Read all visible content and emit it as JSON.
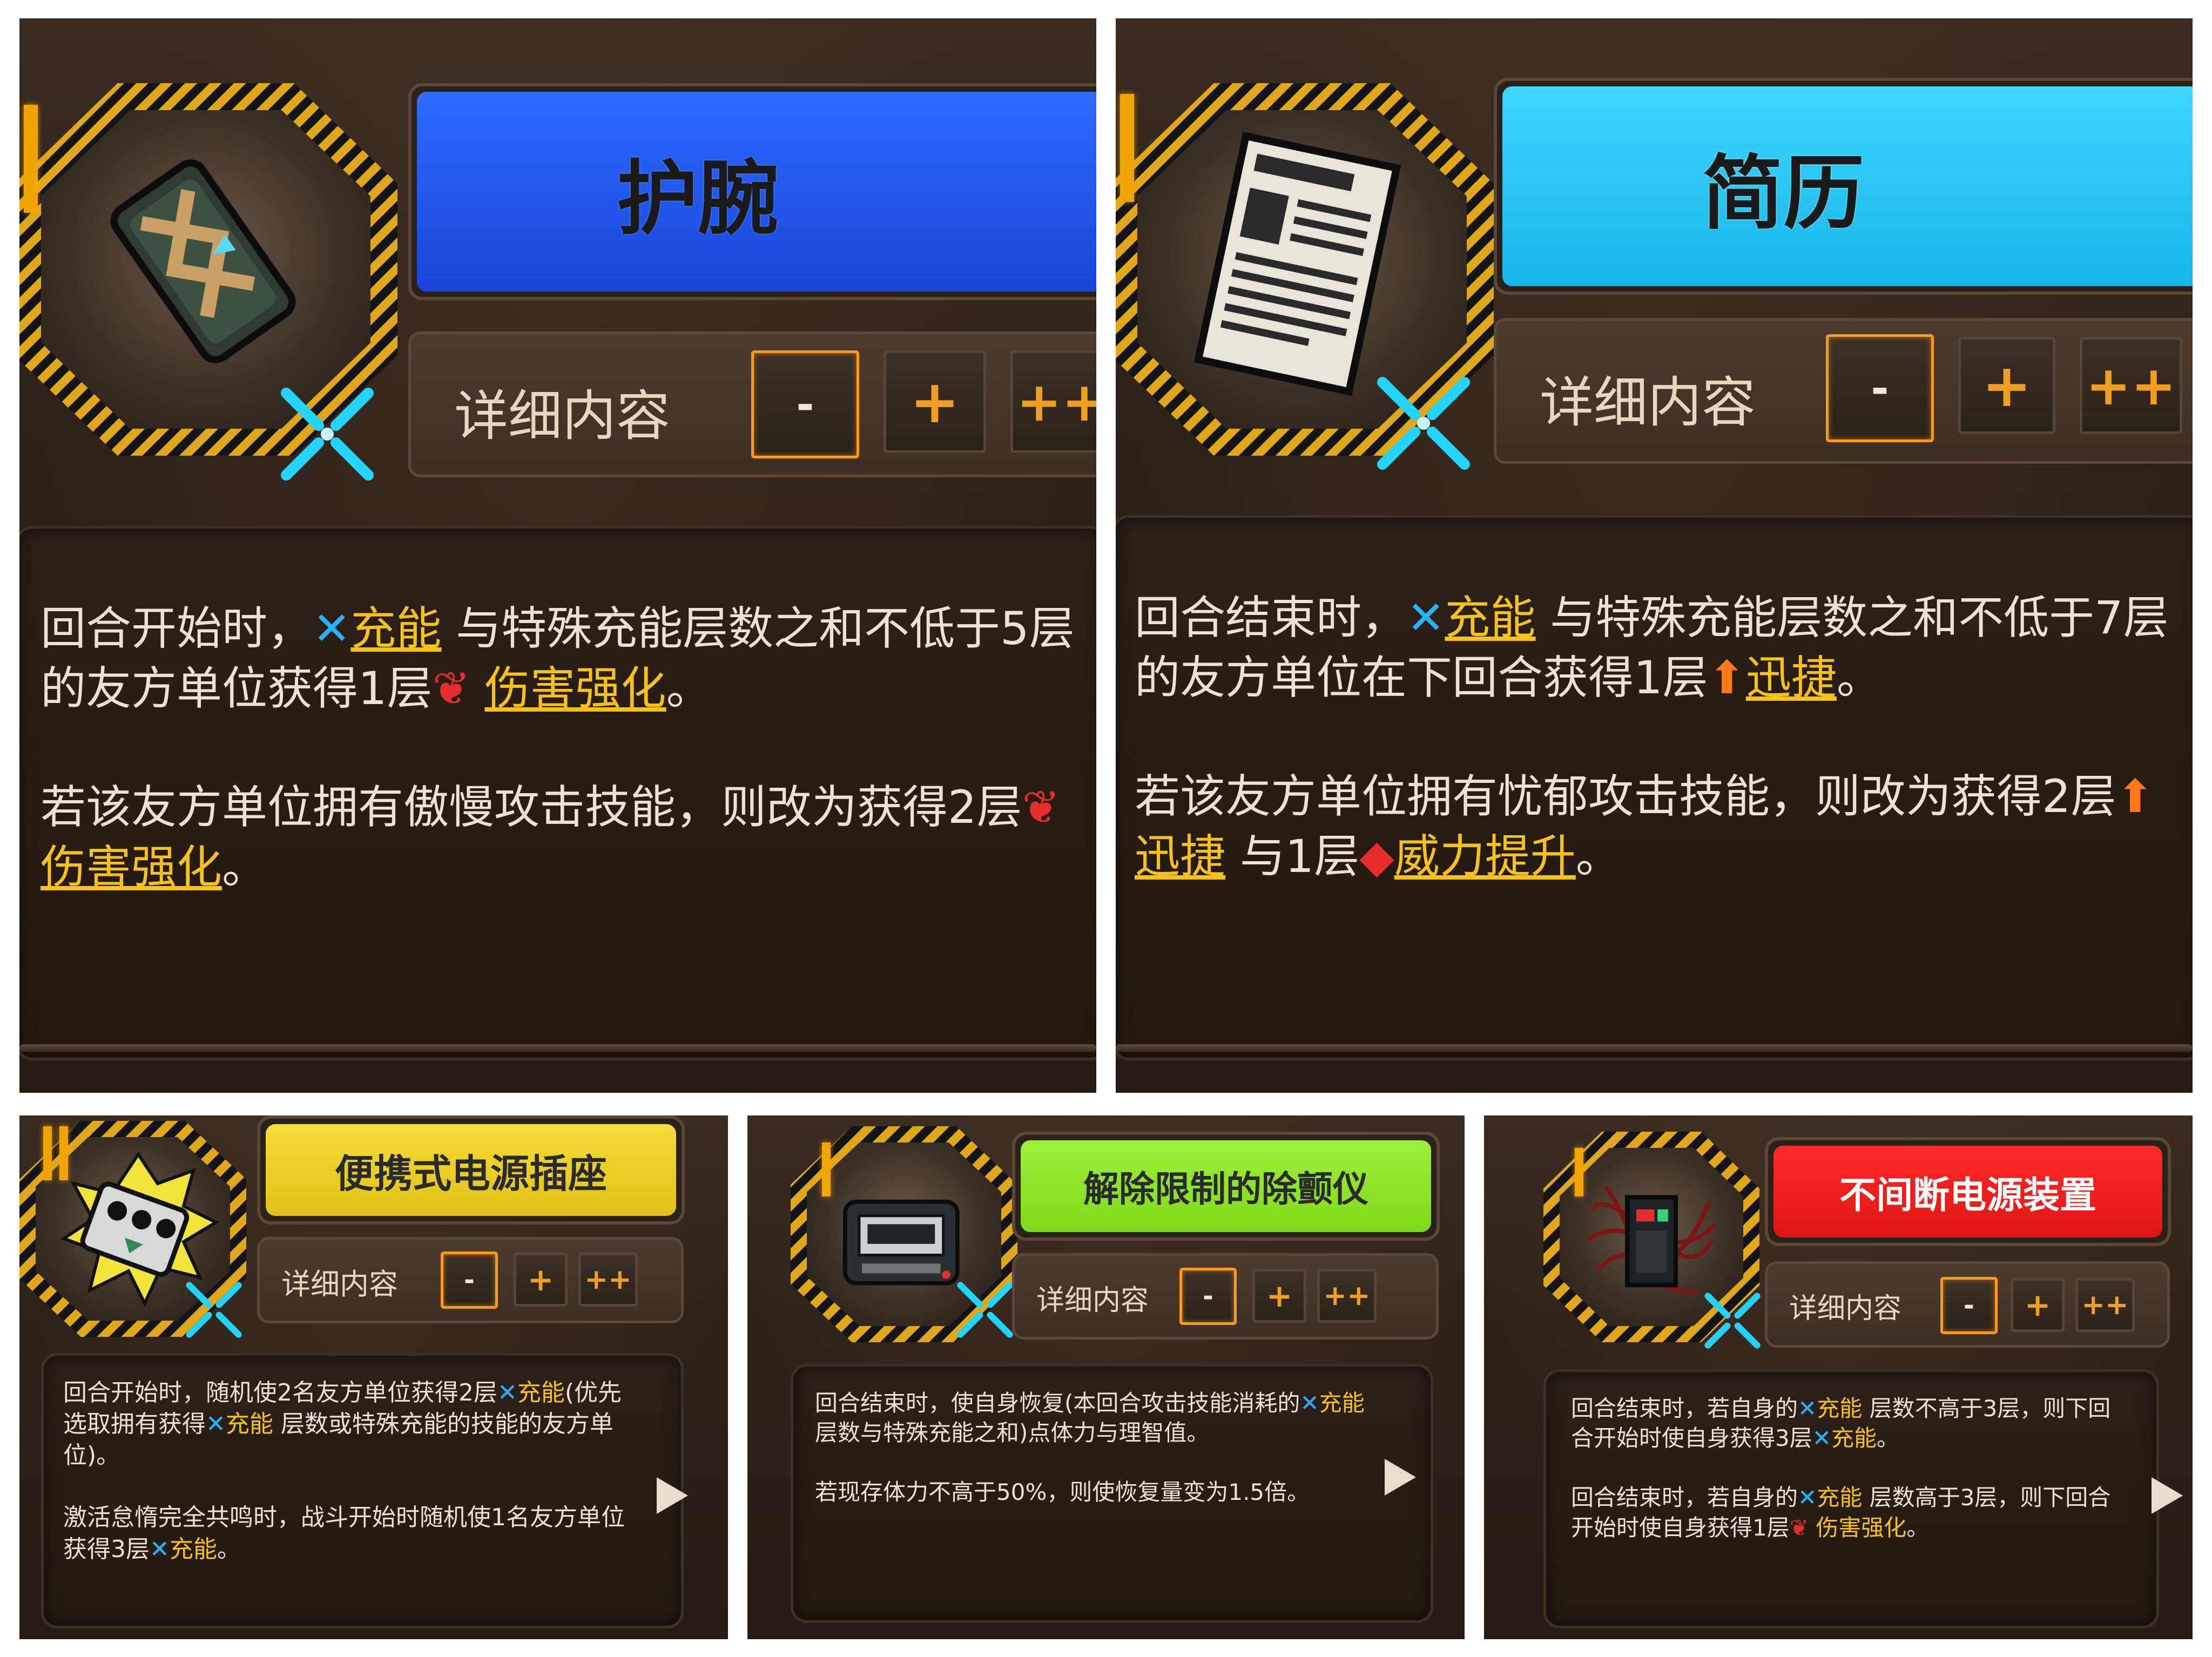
{
  "panels": [
    {
      "name": "护腕",
      "name_color": "#1f55f0",
      "detail_label": "详细内容",
      "buttons": [
        "-",
        "+",
        "++"
      ],
      "paragraphs": [
        [
          {
            "t": "回合开始时，"
          },
          {
            "t": "✕",
            "c": "kw-blue"
          },
          {
            "t": "充能",
            "c": "kw"
          },
          {
            "t": " 与特殊充能层数之和不低于5层的友方单位获得1层"
          },
          {
            "t": "❦",
            "c": "kw-red"
          },
          {
            "t": " "
          },
          {
            "t": "伤害强化",
            "c": "kw"
          },
          {
            "t": "。"
          }
        ],
        [
          {
            "t": "若该友方单位拥有傲慢攻击技能，则改为获得2层"
          },
          {
            "t": "❦",
            "c": "kw-red"
          },
          {
            "t": " "
          },
          {
            "t": "伤害强化",
            "c": "kw"
          },
          {
            "t": "。"
          }
        ]
      ]
    },
    {
      "name": "简历",
      "name_color": "#19c6f5",
      "detail_label": "详细内容",
      "buttons": [
        "-",
        "+",
        "++"
      ],
      "paragraphs": [
        [
          {
            "t": "回合结束时，"
          },
          {
            "t": "✕",
            "c": "kw-blue"
          },
          {
            "t": "充能",
            "c": "kw"
          },
          {
            "t": " 与特殊充能层数之和不低于7层的友方单位在下回合获得1层"
          },
          {
            "t": "⬆",
            "c": "kw-orange"
          },
          {
            "t": "迅捷",
            "c": "kw"
          },
          {
            "t": "。"
          }
        ],
        [
          {
            "t": "若该友方单位拥有忧郁攻击技能，则改为获得2层"
          },
          {
            "t": "⬆",
            "c": "kw-orange"
          },
          {
            "t": "迅捷",
            "c": "kw"
          },
          {
            "t": " 与1层"
          },
          {
            "t": "◆",
            "c": "kw-red"
          },
          {
            "t": "威力提升",
            "c": "kw"
          },
          {
            "t": "。"
          }
        ]
      ]
    },
    {
      "name": "便携式电源插座",
      "name_color": "#efd322",
      "detail_label": "详细内容",
      "buttons": [
        "-",
        "+",
        "++"
      ],
      "paragraphs": [
        [
          {
            "t": "回合开始时，随机使2名友方单位获得2层"
          },
          {
            "t": "✕",
            "c": "kw-blue"
          },
          {
            "t": "充能",
            "c": "kw-plain"
          },
          {
            "t": "(优先选取拥有获得"
          },
          {
            "t": "✕",
            "c": "kw-blue"
          },
          {
            "t": "充能",
            "c": "kw-plain"
          },
          {
            "t": " 层数或特殊充能的技能的友方单位)。"
          }
        ],
        [
          {
            "t": "激活怠惰完全共鸣时，战斗开始时随机使1名友方单位获得3层"
          },
          {
            "t": "✕",
            "c": "kw-blue"
          },
          {
            "t": "充能",
            "c": "kw-plain"
          },
          {
            "t": "。"
          }
        ]
      ]
    },
    {
      "name": "解除限制的除颤仪",
      "name_color": "#8ee827",
      "detail_label": "详细内容",
      "buttons": [
        "-",
        "+",
        "++"
      ],
      "paragraphs": [
        [
          {
            "t": "回合结束时，使自身恢复(本回合攻击技能消耗的"
          },
          {
            "t": "✕",
            "c": "kw-blue"
          },
          {
            "t": "充能",
            "c": "kw-plain"
          },
          {
            "t": " 层数与特殊充能之和)点体力与理智值。"
          }
        ],
        [
          {
            "t": "若现存体力不高于50%，则使恢复量变为1.5倍。"
          }
        ]
      ]
    },
    {
      "name": "不间断电源装置",
      "name_color": "#f21c1c",
      "detail_label": "详细内容",
      "buttons": [
        "-",
        "+",
        "++"
      ],
      "paragraphs": [
        [
          {
            "t": "回合结束时，若自身的"
          },
          {
            "t": "✕",
            "c": "kw-blue"
          },
          {
            "t": "充能",
            "c": "kw-plain"
          },
          {
            "t": " 层数不高于3层，则下回合开始时使自身获得3层"
          },
          {
            "t": "✕",
            "c": "kw-blue"
          },
          {
            "t": "充能",
            "c": "kw-plain"
          },
          {
            "t": "。"
          }
        ],
        [
          {
            "t": "回合结束时，若自身的"
          },
          {
            "t": "✕",
            "c": "kw-blue"
          },
          {
            "t": "充能",
            "c": "kw-plain"
          },
          {
            "t": " 层数高于3层，则下回合开始时使自身获得1层"
          },
          {
            "t": "❦",
            "c": "kw-red"
          },
          {
            "t": " "
          },
          {
            "t": "伤害强化",
            "c": "kw-plain"
          },
          {
            "t": "。"
          }
        ]
      ]
    }
  ],
  "icons": [
    "bracer-icon",
    "resume-icon",
    "power-strip-icon",
    "defibrillator-icon",
    "ups-icon",
    "charge-icon"
  ]
}
